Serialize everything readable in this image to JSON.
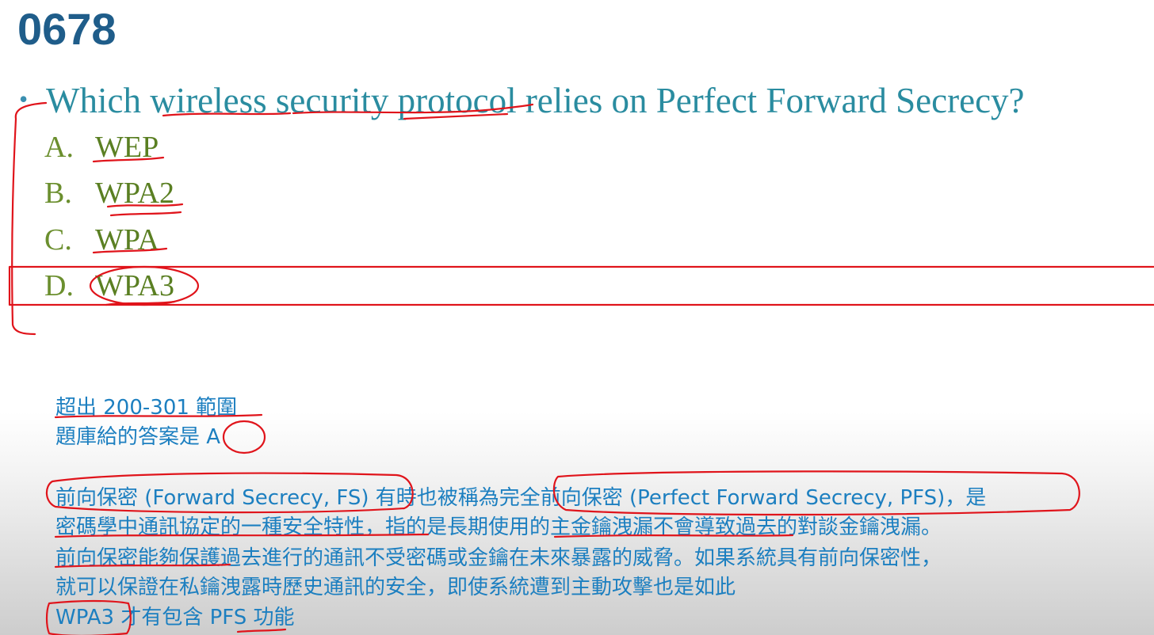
{
  "question_number": "0678",
  "question": {
    "bullet": "•",
    "text": "Which wireless security protocol relies on Perfect Forward Secrecy?"
  },
  "options": [
    {
      "letter": "A.",
      "text": "WEP"
    },
    {
      "letter": "B.",
      "text": "WPA2"
    },
    {
      "letter": "C.",
      "text": "WPA"
    },
    {
      "letter": "D.",
      "text": "WPA3"
    }
  ],
  "notes": {
    "out_of_scope": "超出 200-301 範圍",
    "bank_answer": "題庫給的答案是 A"
  },
  "explanation": [
    "前向保密 (Forward Secrecy, FS) 有時也被稱為完全前向保密 (Perfect Forward Secrecy, PFS)，是",
    "密碼學中通訊協定的一種安全特性，指的是長期使用的主金鑰洩漏不會導致過去的對談金鑰洩漏。",
    "前向保密能夠保護過去進行的通訊不受密碼或金鑰在未來暴露的威脅。如果系統具有前向保密性，",
    "就可以保證在私鑰洩露時歷史通訊的安全，即使系統遭到主動攻擊也是如此",
    "WPA3 才有包含 PFS 功能"
  ],
  "colors": {
    "title": "#1f5d8a",
    "question": "#2a8ca0",
    "options": "#6b8f2e",
    "explanation": "#1c7fc0",
    "annotation_ink": "#e0141b"
  }
}
